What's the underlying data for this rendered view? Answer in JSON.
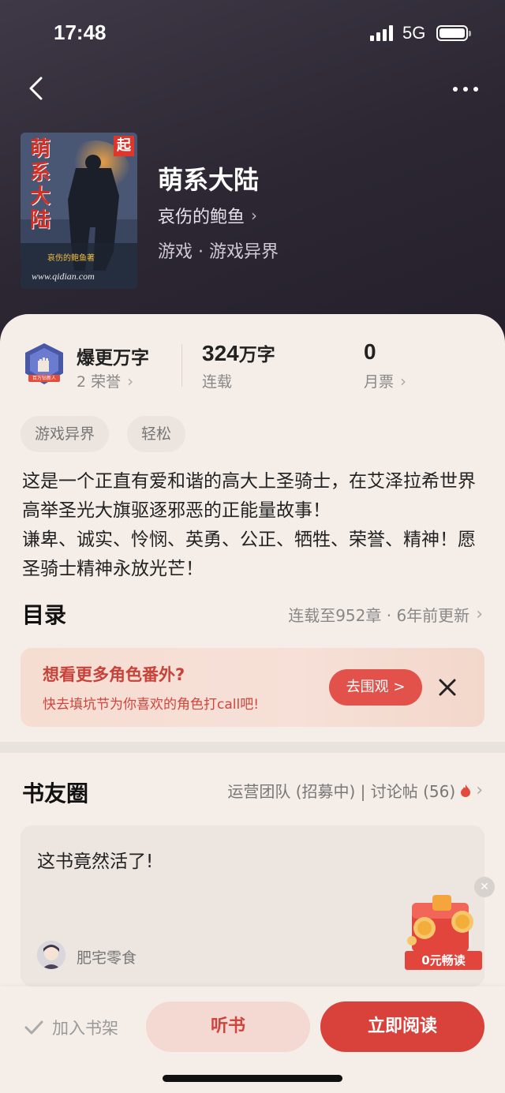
{
  "status_bar": {
    "time": "17:48",
    "network": "5G"
  },
  "book": {
    "title": "萌系大陆",
    "author": "哀伤的鲍鱼",
    "genre": "游戏 · 游戏异界",
    "cover_title_chars": [
      "萌",
      "系",
      "大",
      "陆"
    ],
    "cover_badge": "起",
    "cover_author_line": "哀伤的鲍鱼著",
    "cover_url_text": "www.qidian.com",
    "honor_badge_text": "百万钻新人"
  },
  "stats": {
    "honor": {
      "main": "爆更万字",
      "sub": "2 荣誉"
    },
    "words": {
      "number": "324",
      "unit": "万字",
      "sub": "连载"
    },
    "tickets": {
      "number": "0",
      "sub": "月票"
    }
  },
  "tags": [
    "游戏异界",
    "轻松"
  ],
  "description": [
    "这是一个正直有爱和谐的高大上圣骑士，在艾泽拉希世界高举圣光大旗驱逐邪恶的正能量故事！",
    "谦卑、诚实、怜悯、英勇、公正、牺牲、荣誉、精神！愿圣骑士精神永放光芒！"
  ],
  "toc": {
    "title": "目录",
    "meta": "连载至952章 · 6年前更新"
  },
  "banner": {
    "title": "想看更多角色番外?",
    "subtitle": "快去填坑节为你喜欢的角色打call吧!",
    "button": "去围观 >"
  },
  "circle": {
    "title": "书友圈",
    "meta": "运营团队 (招募中) | 讨论帖 (56)",
    "post": {
      "text": "这书竟然活了!",
      "user": "肥宅零食"
    }
  },
  "promo": {
    "label": "0元畅读"
  },
  "bottom": {
    "shelf": "加入书架",
    "listen": "听书",
    "read": "立即阅读"
  },
  "colors": {
    "accent": "#d8423b",
    "hero_bg": "#2c2733",
    "page_bg": "#f5eee8"
  }
}
